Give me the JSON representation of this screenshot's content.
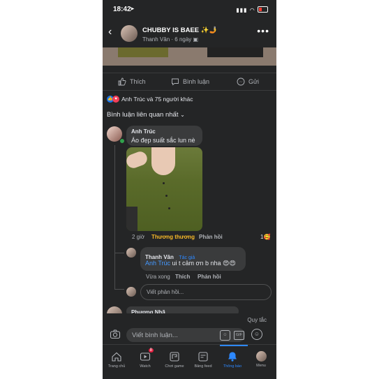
{
  "status": {
    "time": "18:42"
  },
  "header": {
    "title": "CHUBBY IS BAEE ✨🤳",
    "author": "Thanh Vân",
    "time": "6 ngày"
  },
  "actions": {
    "like": "Thích",
    "comment": "Bình luận",
    "send": "Gửi"
  },
  "reactions": {
    "text": "Anh Trúc và 75 người khác"
  },
  "sort_label": "Bình luận liên quan nhất",
  "comment1": {
    "name": "Anh Trúc",
    "text": "Áo đẹp suất sắc lun nè",
    "time": "2 giờ",
    "reaction_label": "Thương thương",
    "reply_label": "Phản hồi",
    "reaction_count": "1"
  },
  "reply1": {
    "name": "Thanh Vân",
    "author_badge": "Tác giả",
    "mention": "Anh Trúc",
    "text": "ui t cảm ơn b nha 😍😍",
    "time": "Vừa xong",
    "like_label": "Thích",
    "reply_label": "Phản hồi"
  },
  "reply_input": {
    "placeholder": "Viết phản hồi..."
  },
  "comment2": {
    "name": "Phương Nhã"
  },
  "rules_link": "Quy tắc",
  "comment_input": {
    "placeholder": "Viết bình luận..."
  },
  "tabs": [
    {
      "label": "Trang chủ",
      "icon": "home-icon"
    },
    {
      "label": "Watch",
      "icon": "watch-icon",
      "badge": "8"
    },
    {
      "label": "Chơi game",
      "icon": "gaming-icon"
    },
    {
      "label": "Bảng feed",
      "icon": "feed-icon"
    },
    {
      "label": "Thông báo",
      "icon": "bell-icon",
      "active": true
    },
    {
      "label": "Menu",
      "icon": "menu-avatar"
    }
  ],
  "colors": {
    "background": "#242526",
    "bubble": "#3a3b3c",
    "accent": "#1877f2",
    "reaction": "#f7b928"
  }
}
